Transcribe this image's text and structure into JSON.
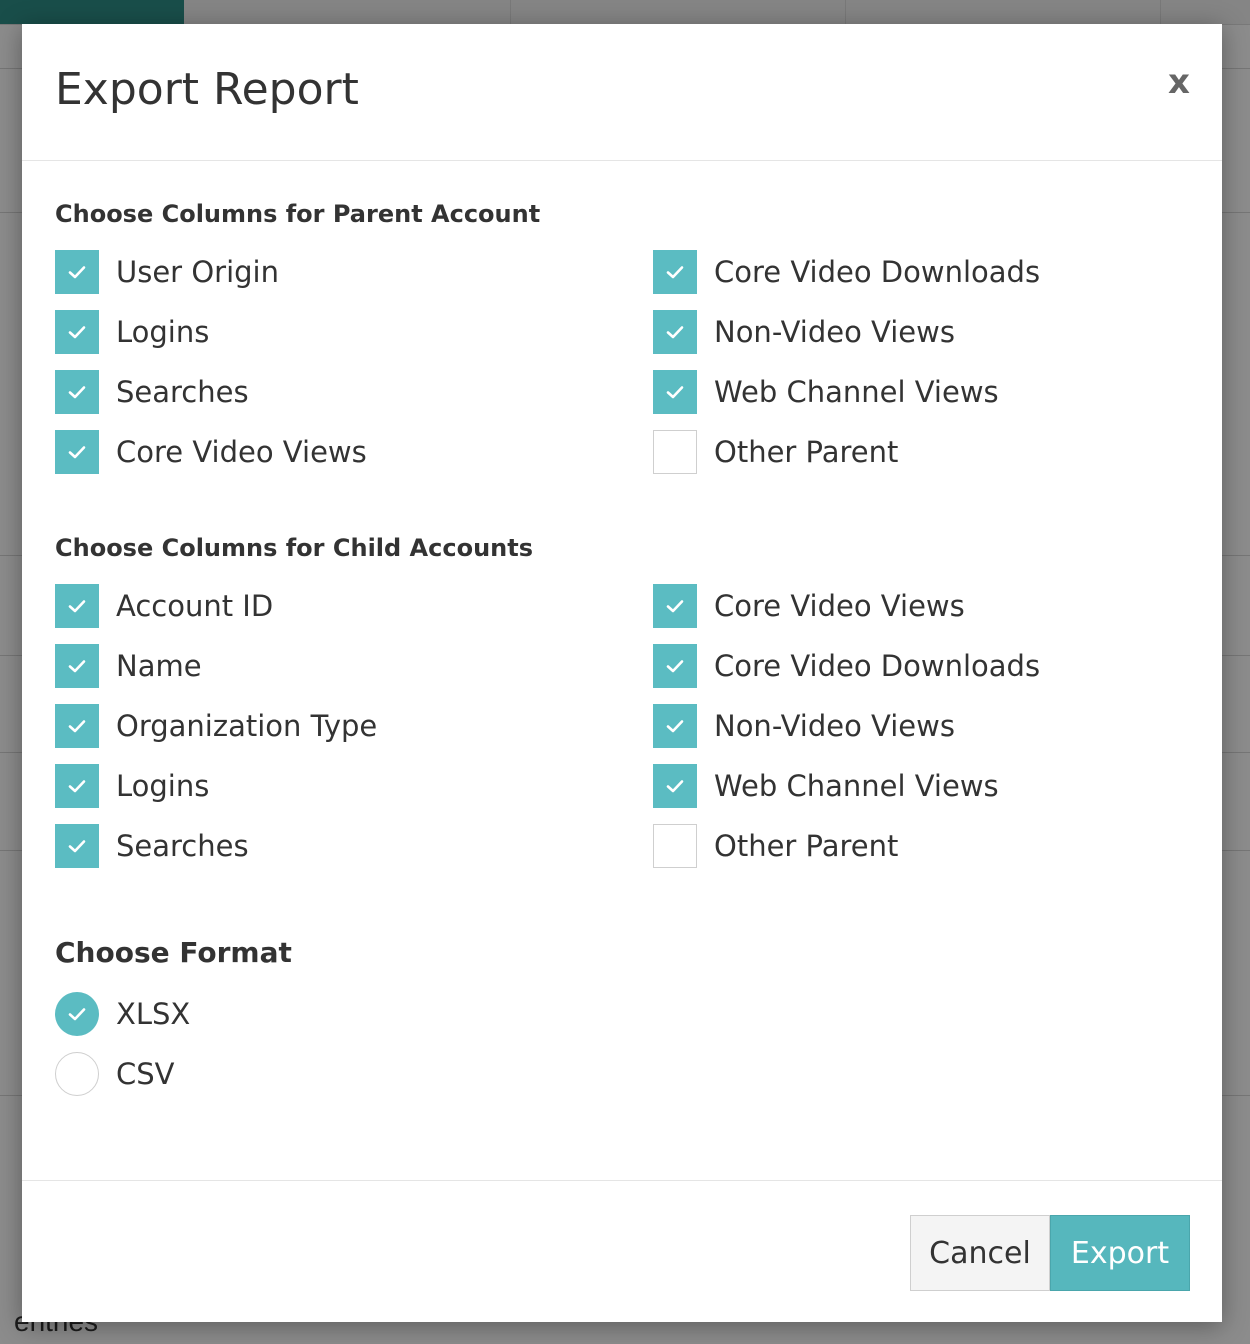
{
  "modal": {
    "title": "Export Report",
    "close_label": "x"
  },
  "parent_section": {
    "title": "Choose Columns for Parent Account",
    "options": [
      {
        "label": "User Origin",
        "checked": true
      },
      {
        "label": "Logins",
        "checked": true
      },
      {
        "label": "Searches",
        "checked": true
      },
      {
        "label": "Core Video Views",
        "checked": true
      },
      {
        "label": "Core Video Downloads",
        "checked": true
      },
      {
        "label": "Non-Video Views",
        "checked": true
      },
      {
        "label": "Web Channel Views",
        "checked": true
      },
      {
        "label": "Other Parent",
        "checked": false
      }
    ]
  },
  "child_section": {
    "title": "Choose Columns for Child Accounts",
    "options": [
      {
        "label": "Account ID",
        "checked": true
      },
      {
        "label": "Name",
        "checked": true
      },
      {
        "label": "Organization Type",
        "checked": true
      },
      {
        "label": "Logins",
        "checked": true
      },
      {
        "label": "Searches",
        "checked": true
      },
      {
        "label": "Core Video Views",
        "checked": true
      },
      {
        "label": "Core Video Downloads",
        "checked": true
      },
      {
        "label": "Non-Video Views",
        "checked": true
      },
      {
        "label": "Web Channel Views",
        "checked": true
      },
      {
        "label": "Other Parent",
        "checked": false
      }
    ]
  },
  "format_section": {
    "title": "Choose Format",
    "options": [
      {
        "label": "XLSX",
        "selected": true
      },
      {
        "label": "CSV",
        "selected": false
      }
    ]
  },
  "footer": {
    "cancel_label": "Cancel",
    "export_label": "Export"
  },
  "background": {
    "entries_text": "entries"
  },
  "colors": {
    "accent": "#5bbcc2",
    "export_button": "#56b7bd",
    "title_text": "#333333"
  },
  "icons": {
    "check": "check-icon",
    "close": "close-icon"
  }
}
